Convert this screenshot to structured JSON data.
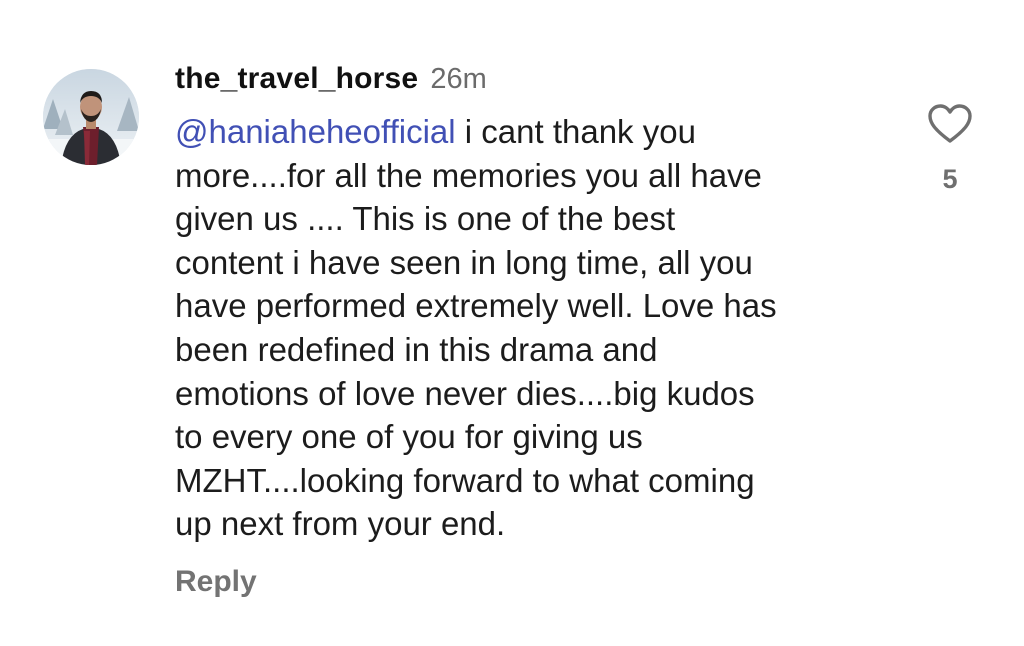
{
  "comment": {
    "username": "the_travel_horse",
    "timestamp": "26m",
    "mention": "@haniaheheofficial",
    "text": " i cant thank you\nmore....for all the memories you all have\ngiven us .... This is one of the best\ncontent i have seen in long time, all you\nhave performed extremely well. Love has\nbeen redefined in this drama and\nemotions of love never dies....big kudos\nto every one of you for giving us\nMZHT....looking forward to what coming\nup next from your end.",
    "reply_label": "Reply",
    "like_count": "5",
    "like_icon": "heart-outline-icon",
    "mention_color": "#4150b5"
  }
}
